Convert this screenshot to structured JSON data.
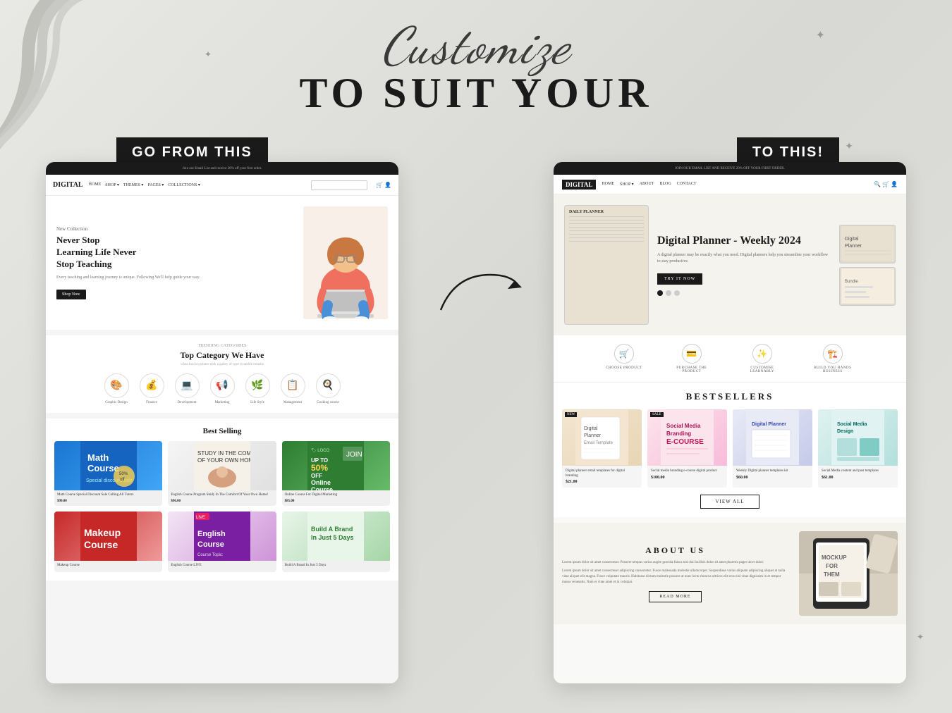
{
  "page": {
    "background": "#e8e8e4",
    "title": "Customize to Suit Your",
    "customize_script": "Customize",
    "to_suit_your": "TO SUIT YOUR"
  },
  "labels": {
    "left_badge": "GO FROM THIS",
    "right_badge": "TO THIS!"
  },
  "left_screen": {
    "topbar": "Join our Email List and receive 20% off your first order.",
    "logo": "DIGITAL",
    "nav_links": [
      "HOME",
      "SHOP ▾",
      "THEMES ▾",
      "PAGES ▾",
      "COLLECTIONS ▾"
    ],
    "hero_small": "New Collection",
    "hero_h1": "Never Stop Learning Life Never Stop Teaching",
    "hero_p": "Every teaching and learning journey is unique. Following We'll help guide your way.",
    "hero_btn": "Shop Now",
    "categories_label": "TRENDING CATEGORIES",
    "categories_title": "Top Category We Have",
    "categories_subtitle": "when known printer took a galley of type scramble remake",
    "categories": [
      "Graphic Design",
      "Finance",
      "Development",
      "Marketing",
      "Life Style",
      "Management",
      "Cooking course"
    ],
    "bestselling_title": "Best Selling",
    "products": [
      {
        "name": "Math Course Special Discount Sale Calling All Tutors",
        "price": "$99.00",
        "emoji": "📚",
        "color": "math"
      },
      {
        "name": "English Course Program Study In The Comfort Of Your Own Home!",
        "price": "$96.00",
        "emoji": "☕",
        "color": "english"
      },
      {
        "name": "Online Course For Digital Marketing",
        "price": "$85.00",
        "emoji": "🎓",
        "color": "online"
      }
    ],
    "products2": [
      {
        "name": "Makeup Course",
        "emoji": "💄",
        "color": "makeup"
      },
      {
        "name": "English Course LIVE",
        "emoji": "📖",
        "color": "english2"
      },
      {
        "name": "Build A Brand In Just 5 Days",
        "emoji": "🚀",
        "color": "build"
      }
    ]
  },
  "right_screen": {
    "topbar": "JOIN OUR EMAIL LIST AND RECEIVE 20% OFF YOUR FIRST ORDER.",
    "logo": "DIGITAL",
    "nav_links": [
      "HOME",
      "SHOP ▾",
      "ABOUT",
      "BLOG",
      "CONTACT"
    ],
    "hero_h1": "Digital Planner - Weekly 2024",
    "hero_p": "A digital planner may be exactly what you need. Digital planners help you streamline your workflow to stay productive.",
    "hero_btn": "TRY IT NOW",
    "steps": [
      {
        "icon": "🛒",
        "label": "CHOOSE PRODUCT"
      },
      {
        "icon": "💳",
        "label": "PURCHASE THE PRODUCT"
      },
      {
        "icon": "✨",
        "label": "CUSTOMISE LEARNABLY"
      },
      {
        "icon": "🏗️",
        "label": "BUILD YOU HANDS BUSINESS"
      }
    ],
    "bestsellers_title": "BESTSELLERS",
    "products": [
      {
        "name": "Digital planner email templates for digital branding",
        "price": "$21.00",
        "badge": "NEW",
        "emoji": "📧",
        "color": "planner"
      },
      {
        "name": "Social media branding e-course digital product",
        "price": "$100.00",
        "badge": "SALE",
        "emoji": "📱",
        "color": "branding"
      },
      {
        "name": "Weekly Digital planner templates kit",
        "price": "$60.00",
        "badge": "",
        "emoji": "📅",
        "color": "weekly"
      },
      {
        "name": "Social Media content and post templates",
        "price": "$61.00",
        "badge": "",
        "emoji": "📊",
        "color": "social"
      }
    ],
    "view_all_btn": "VIEW ALL",
    "about_title": "ABOUT US",
    "about_p1": "Lorem ipsum dolor sit amet consecteuer. Posuere tempus varius augite gravida fuisca nisl dui facilisis dolor sit amet pharetra pager ulcer dolor.",
    "about_p2": "Lorem ipsum dolor sit amet consecteuer adipiscing consectetur. Fusce malesuada molestie ullamcorper. Suspendisse varius aliquam adipiscing aliquet at nulla vitae aliquet elit magna. Fusce vulputate mauris. Habitasse dictum molestie posuere at nunc lecto rhoncus ultrices elit eros nisl vitae dignissim in et tempor massa venenatis. Nam et vitae amet et in volutpat.",
    "read_more_btn": "READ MORE",
    "mockup_label": "MOCKUP FOR THEM"
  },
  "arrow": {
    "description": "curved arrow pointing right from left screen to right screen"
  }
}
